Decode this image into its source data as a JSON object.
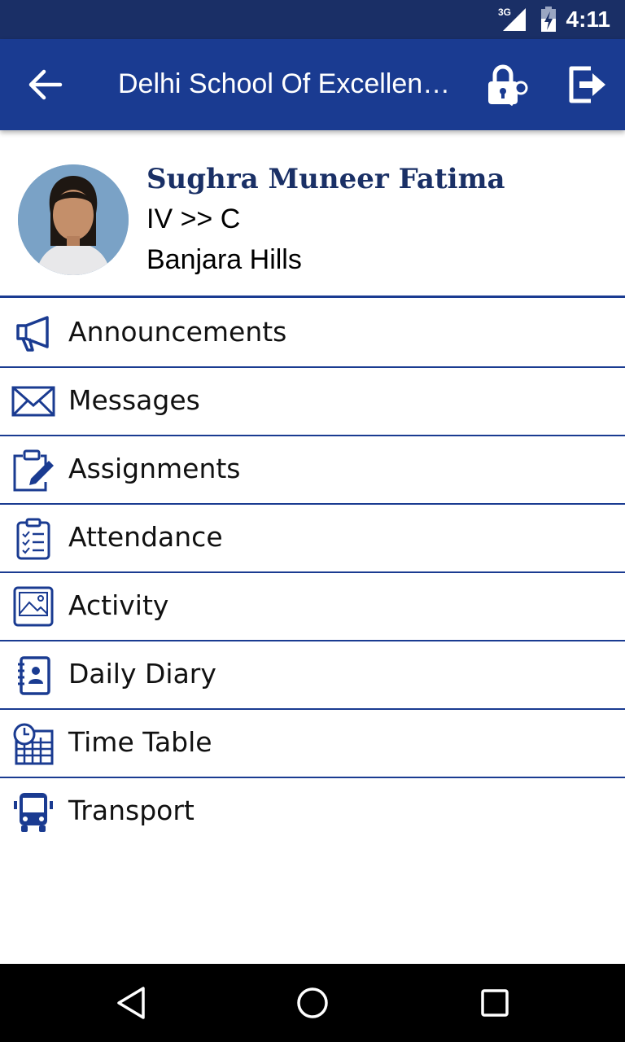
{
  "status_bar": {
    "network": "3G",
    "time": "4:11"
  },
  "app_bar": {
    "title": "Delhi School Of Excellen…"
  },
  "profile": {
    "name": "Sughra Muneer Fatima",
    "class_section": "IV >> C",
    "branch": "Banjara Hills"
  },
  "menu": [
    {
      "label": "Announcements",
      "icon": "megaphone-icon"
    },
    {
      "label": "Messages",
      "icon": "envelope-icon"
    },
    {
      "label": "Assignments",
      "icon": "clipboard-pencil-icon"
    },
    {
      "label": "Attendance",
      "icon": "checklist-icon"
    },
    {
      "label": "Activity",
      "icon": "image-icon"
    },
    {
      "label": "Daily Diary",
      "icon": "contact-book-icon"
    },
    {
      "label": "Time Table",
      "icon": "clock-calendar-icon"
    },
    {
      "label": "Transport",
      "icon": "bus-icon"
    }
  ],
  "colors": {
    "primary": "#1a3b91",
    "status_bar": "#1a2f66",
    "name_text": "#1a3066",
    "divider": "#1a3b91"
  }
}
